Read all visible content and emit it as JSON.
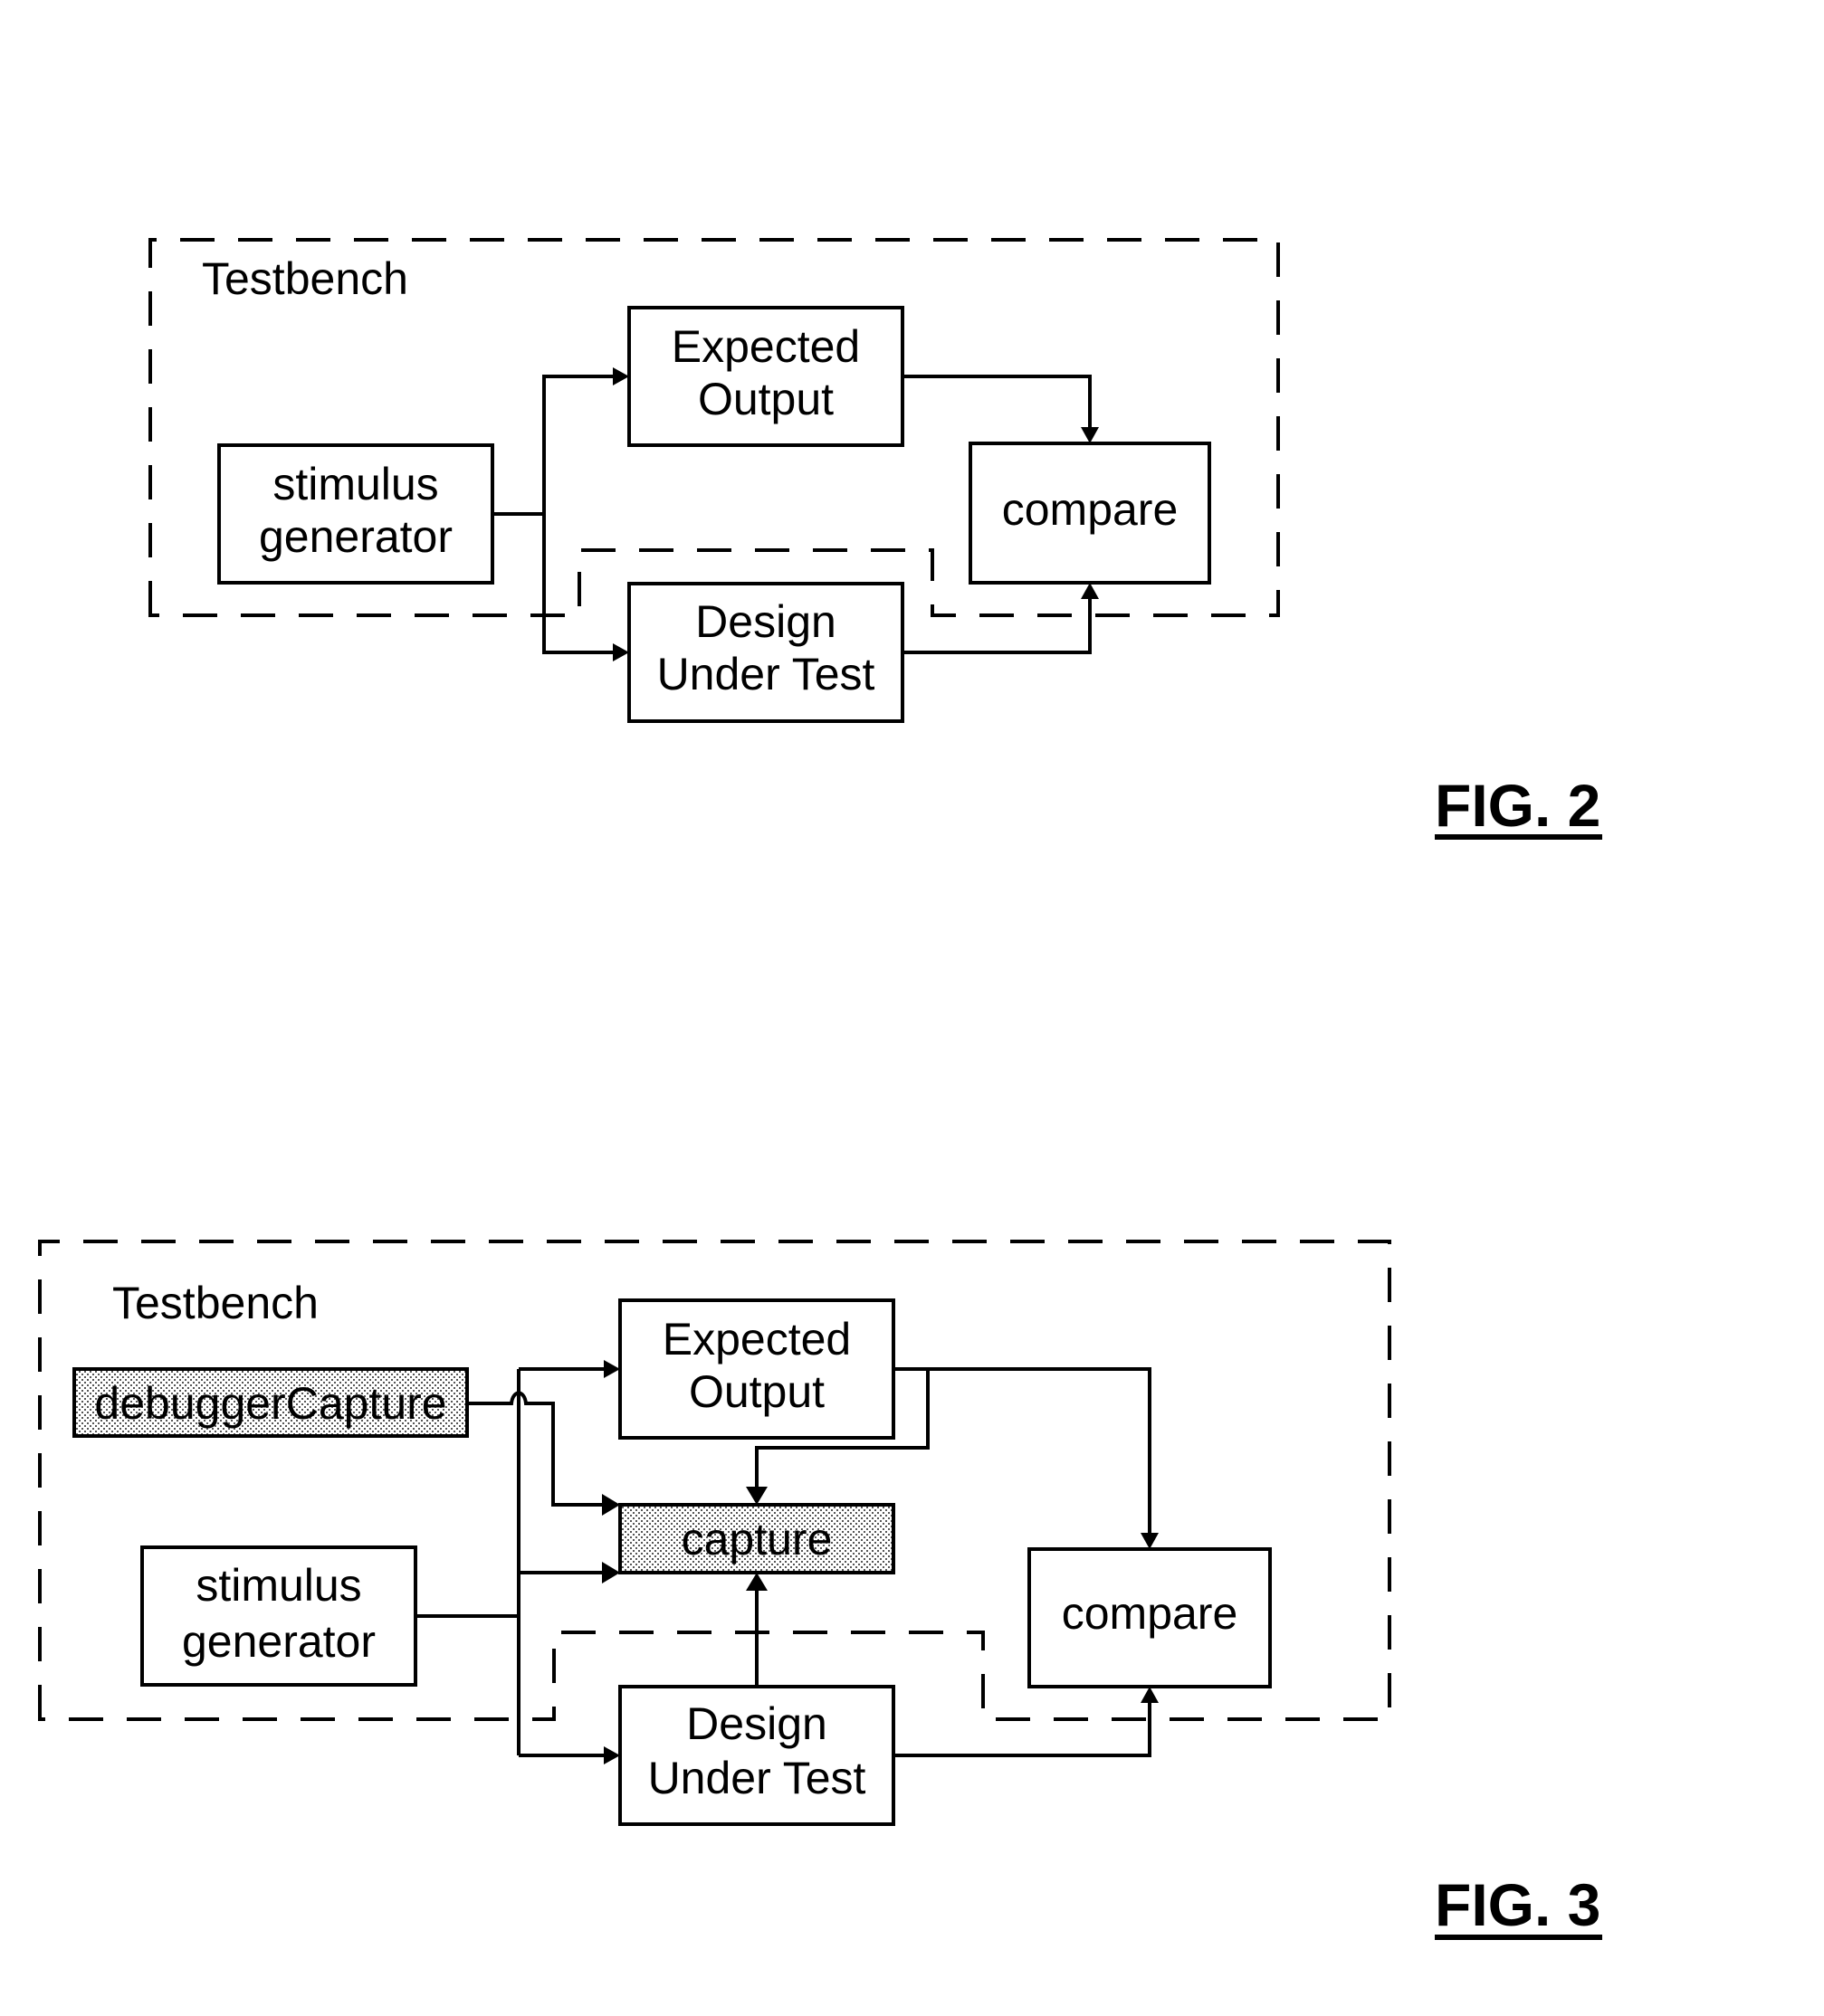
{
  "figures": [
    {
      "id": "fig2",
      "caption": "FIG. 2",
      "container_label": "Testbench",
      "blocks": {
        "stimulus": [
          "stimulus",
          "generator"
        ],
        "expected": [
          "Expected",
          "Output"
        ],
        "compare": [
          "compare"
        ],
        "dut": [
          "Design",
          "Under Test"
        ]
      },
      "connections": [
        {
          "from": "stimulus generator",
          "to": "Expected Output"
        },
        {
          "from": "stimulus generator",
          "to": "Design Under Test"
        },
        {
          "from": "Expected Output",
          "to": "compare"
        },
        {
          "from": "Design Under Test",
          "to": "compare"
        }
      ]
    },
    {
      "id": "fig3",
      "caption": "FIG. 3",
      "container_label": "Testbench",
      "blocks": {
        "debugger": [
          "debuggerCapture"
        ],
        "stimulus": [
          "stimulus",
          "generator"
        ],
        "expected": [
          "Expected",
          "Output"
        ],
        "capture": [
          "capture"
        ],
        "compare": [
          "compare"
        ],
        "dut": [
          "Design",
          "Under Test"
        ]
      },
      "shaded_blocks": [
        "debuggerCapture",
        "capture"
      ],
      "connections": [
        {
          "from": "debuggerCapture",
          "to": "capture"
        },
        {
          "from": "stimulus generator",
          "to": "Expected Output"
        },
        {
          "from": "stimulus generator",
          "to": "capture"
        },
        {
          "from": "stimulus generator",
          "to": "Design Under Test"
        },
        {
          "from": "Expected Output",
          "to": "capture"
        },
        {
          "from": "Expected Output",
          "to": "compare"
        },
        {
          "from": "Design Under Test",
          "to": "capture"
        },
        {
          "from": "Design Under Test",
          "to": "compare"
        }
      ]
    }
  ]
}
